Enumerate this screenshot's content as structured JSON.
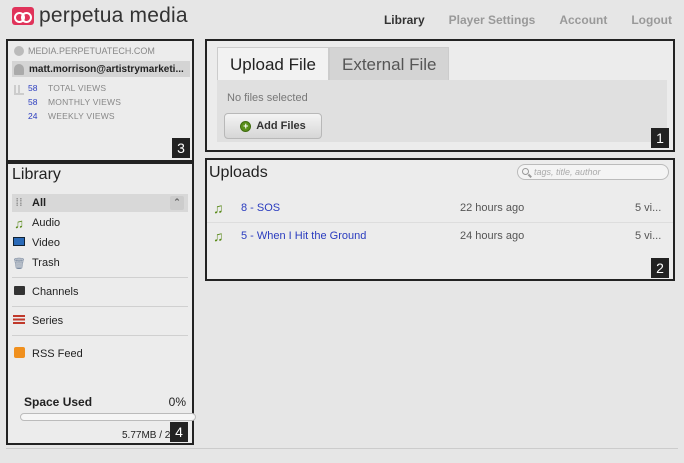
{
  "app": {
    "logo_text": "perpetua media"
  },
  "nav": {
    "items": [
      {
        "label": "Library",
        "active": true
      },
      {
        "label": "Player Settings",
        "active": false
      },
      {
        "label": "Account",
        "active": false
      },
      {
        "label": "Logout",
        "active": false
      }
    ]
  },
  "account": {
    "domain": "MEDIA.PERPETUATECH.COM",
    "user": "matt.morrison@artistrymarketi...",
    "stats": [
      {
        "value": "58",
        "label": "TOTAL VIEWS"
      },
      {
        "value": "58",
        "label": "MONTHLY VIEWS"
      },
      {
        "value": "24",
        "label": "WEEKLY VIEWS"
      }
    ],
    "badge": "3"
  },
  "upload": {
    "tabs": [
      {
        "label": "Upload File",
        "active": true
      },
      {
        "label": "External File",
        "active": false
      }
    ],
    "status": "No files selected",
    "add_button": "Add Files",
    "badge": "1"
  },
  "uploads": {
    "title": "Uploads",
    "search_placeholder": "tags, title, author",
    "rows": [
      {
        "title": "8 - SOS",
        "time": "22 hours ago",
        "views": "5 vi..."
      },
      {
        "title": "5 - When I Hit the Ground",
        "time": "24 hours ago",
        "views": "5 vi..."
      }
    ],
    "badge": "2"
  },
  "library": {
    "title": "Library",
    "items": [
      {
        "label": "All",
        "icon": "grid-icon",
        "selected": true
      },
      {
        "label": "Audio",
        "icon": "music-note-icon",
        "selected": false
      },
      {
        "label": "Video",
        "icon": "monitor-icon",
        "selected": false
      },
      {
        "label": "Trash",
        "icon": "trash-icon",
        "selected": false
      }
    ],
    "channels": "Channels",
    "series": "Series",
    "rss": "RSS Feed",
    "space_label": "Space Used",
    "space_pct": "0%",
    "space_fraction": 0.0,
    "space_size": "5.77MB / 2",
    "badge": "4"
  },
  "colors": {
    "brand": "#e0335a",
    "link": "#2a3cbf",
    "badge_bg": "#222222"
  }
}
